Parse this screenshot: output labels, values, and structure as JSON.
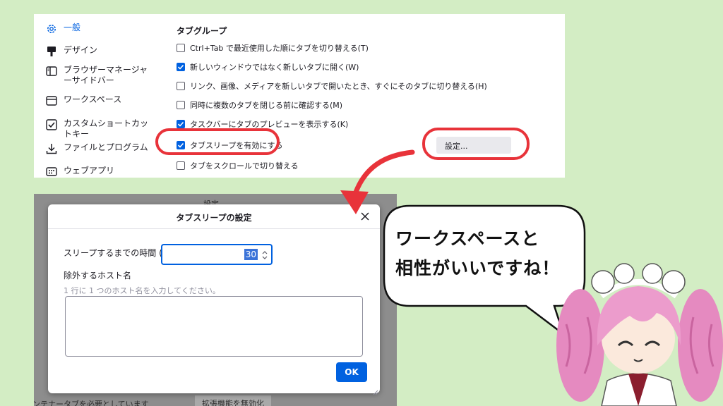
{
  "sidebar": {
    "items": [
      {
        "label": "一般",
        "icon": "gear-icon",
        "active": true
      },
      {
        "label": "デザイン",
        "icon": "paintbrush-icon",
        "active": false
      },
      {
        "label": "ブラウザーマネージャーサイドバー",
        "icon": "sidebar-icon",
        "active": false
      },
      {
        "label": "ワークスペース",
        "icon": "workspace-icon",
        "active": false
      },
      {
        "label": "カスタムショートカットキー",
        "icon": "checkbox-icon",
        "active": false
      },
      {
        "label": "ファイルとプログラム",
        "icon": "download-icon",
        "active": false
      },
      {
        "label": "ウェブアプリ",
        "icon": "webapp-icon",
        "active": false
      }
    ]
  },
  "tab_group": {
    "title": "タブグループ",
    "options": [
      {
        "label": "Ctrl+Tab で最近使用した順にタブを切り替える(T)",
        "checked": false
      },
      {
        "label": "新しいウィンドウではなく新しいタブに開く(W)",
        "checked": true
      },
      {
        "label": "リンク、画像、メディアを新しいタブで開いたとき、すぐにそのタブに切り替える(H)",
        "checked": false
      },
      {
        "label": "同時に複数のタブを閉じる前に確認する(M)",
        "checked": false
      },
      {
        "label": "タスクバーにタブのプレビューを表示する(K)",
        "checked": true
      },
      {
        "label": "タブスリープを有効にする",
        "checked": true
      },
      {
        "label": "タブをスクロールで切り替える",
        "checked": false
      }
    ],
    "settings_button": "設定..."
  },
  "background": {
    "top_text": "設定",
    "bottom_text": "ンテナータブを必要としています",
    "bottom_button": "拡張機能を無効化"
  },
  "dialog": {
    "title": "タブスリープの設定",
    "sleep_time_label": "スリープするまでの時間 (分)",
    "sleep_time_value": "30",
    "exclude_hosts_label": "除外するホスト名",
    "exclude_hosts_hint": "1 行に 1 つのホスト名を入力してください。",
    "ok_button": "OK"
  },
  "speech_bubble": {
    "text": "ワークスペースと\n相性がいいですね！"
  },
  "colors": {
    "background": "#d3edc4",
    "accent": "#0061e0",
    "highlight_ring": "#e8333a"
  }
}
